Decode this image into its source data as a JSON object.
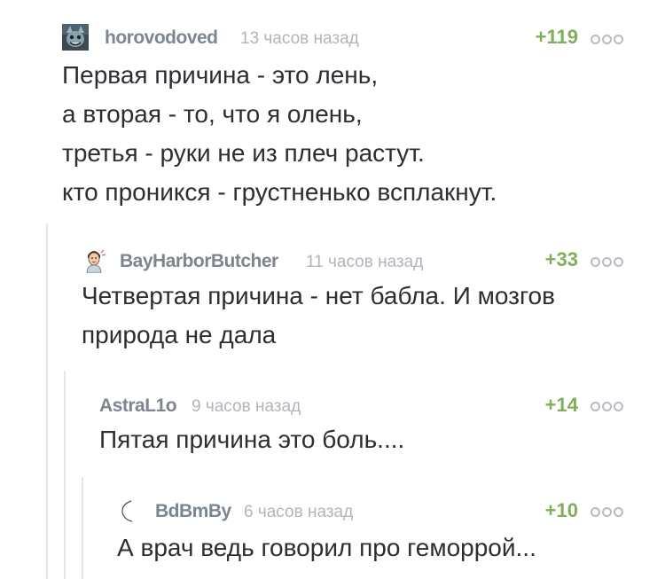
{
  "comments": [
    {
      "username": "horovodoved",
      "timestamp": "13 часов назад",
      "rating": "+119",
      "avatar_icon": "cat-avatar-icon",
      "lines": [
        "Первая причина - это лень,",
        "а вторая - то, что я олень,",
        "третья - руки не из плеч растут.",
        "кто проникся - грустненько всплакнут."
      ]
    },
    {
      "username": "BayHarborButcher",
      "timestamp": "11 часов назад",
      "rating": "+33",
      "avatar_icon": "person-avatar-icon",
      "lines": [
        "Четвертая причина - нет бабла. И мозгов",
        "природа не дала"
      ]
    },
    {
      "username": "AstraL1o",
      "timestamp": "9 часов назад",
      "rating": "+14",
      "lines": [
        "Пятая причина это боль...."
      ]
    },
    {
      "username": "BdBmBy",
      "timestamp": "6 часов назад",
      "rating": "+10",
      "avatar_icon": "moon-avatar-icon",
      "lines": [
        "А врач ведь говорил про геморрой..."
      ]
    }
  ],
  "colors": {
    "username": "#7d8690",
    "timestamp": "#b0b5bb",
    "rating": "#7faf5b",
    "text": "#2b2f33",
    "thread_line": "#e6e6e6"
  }
}
